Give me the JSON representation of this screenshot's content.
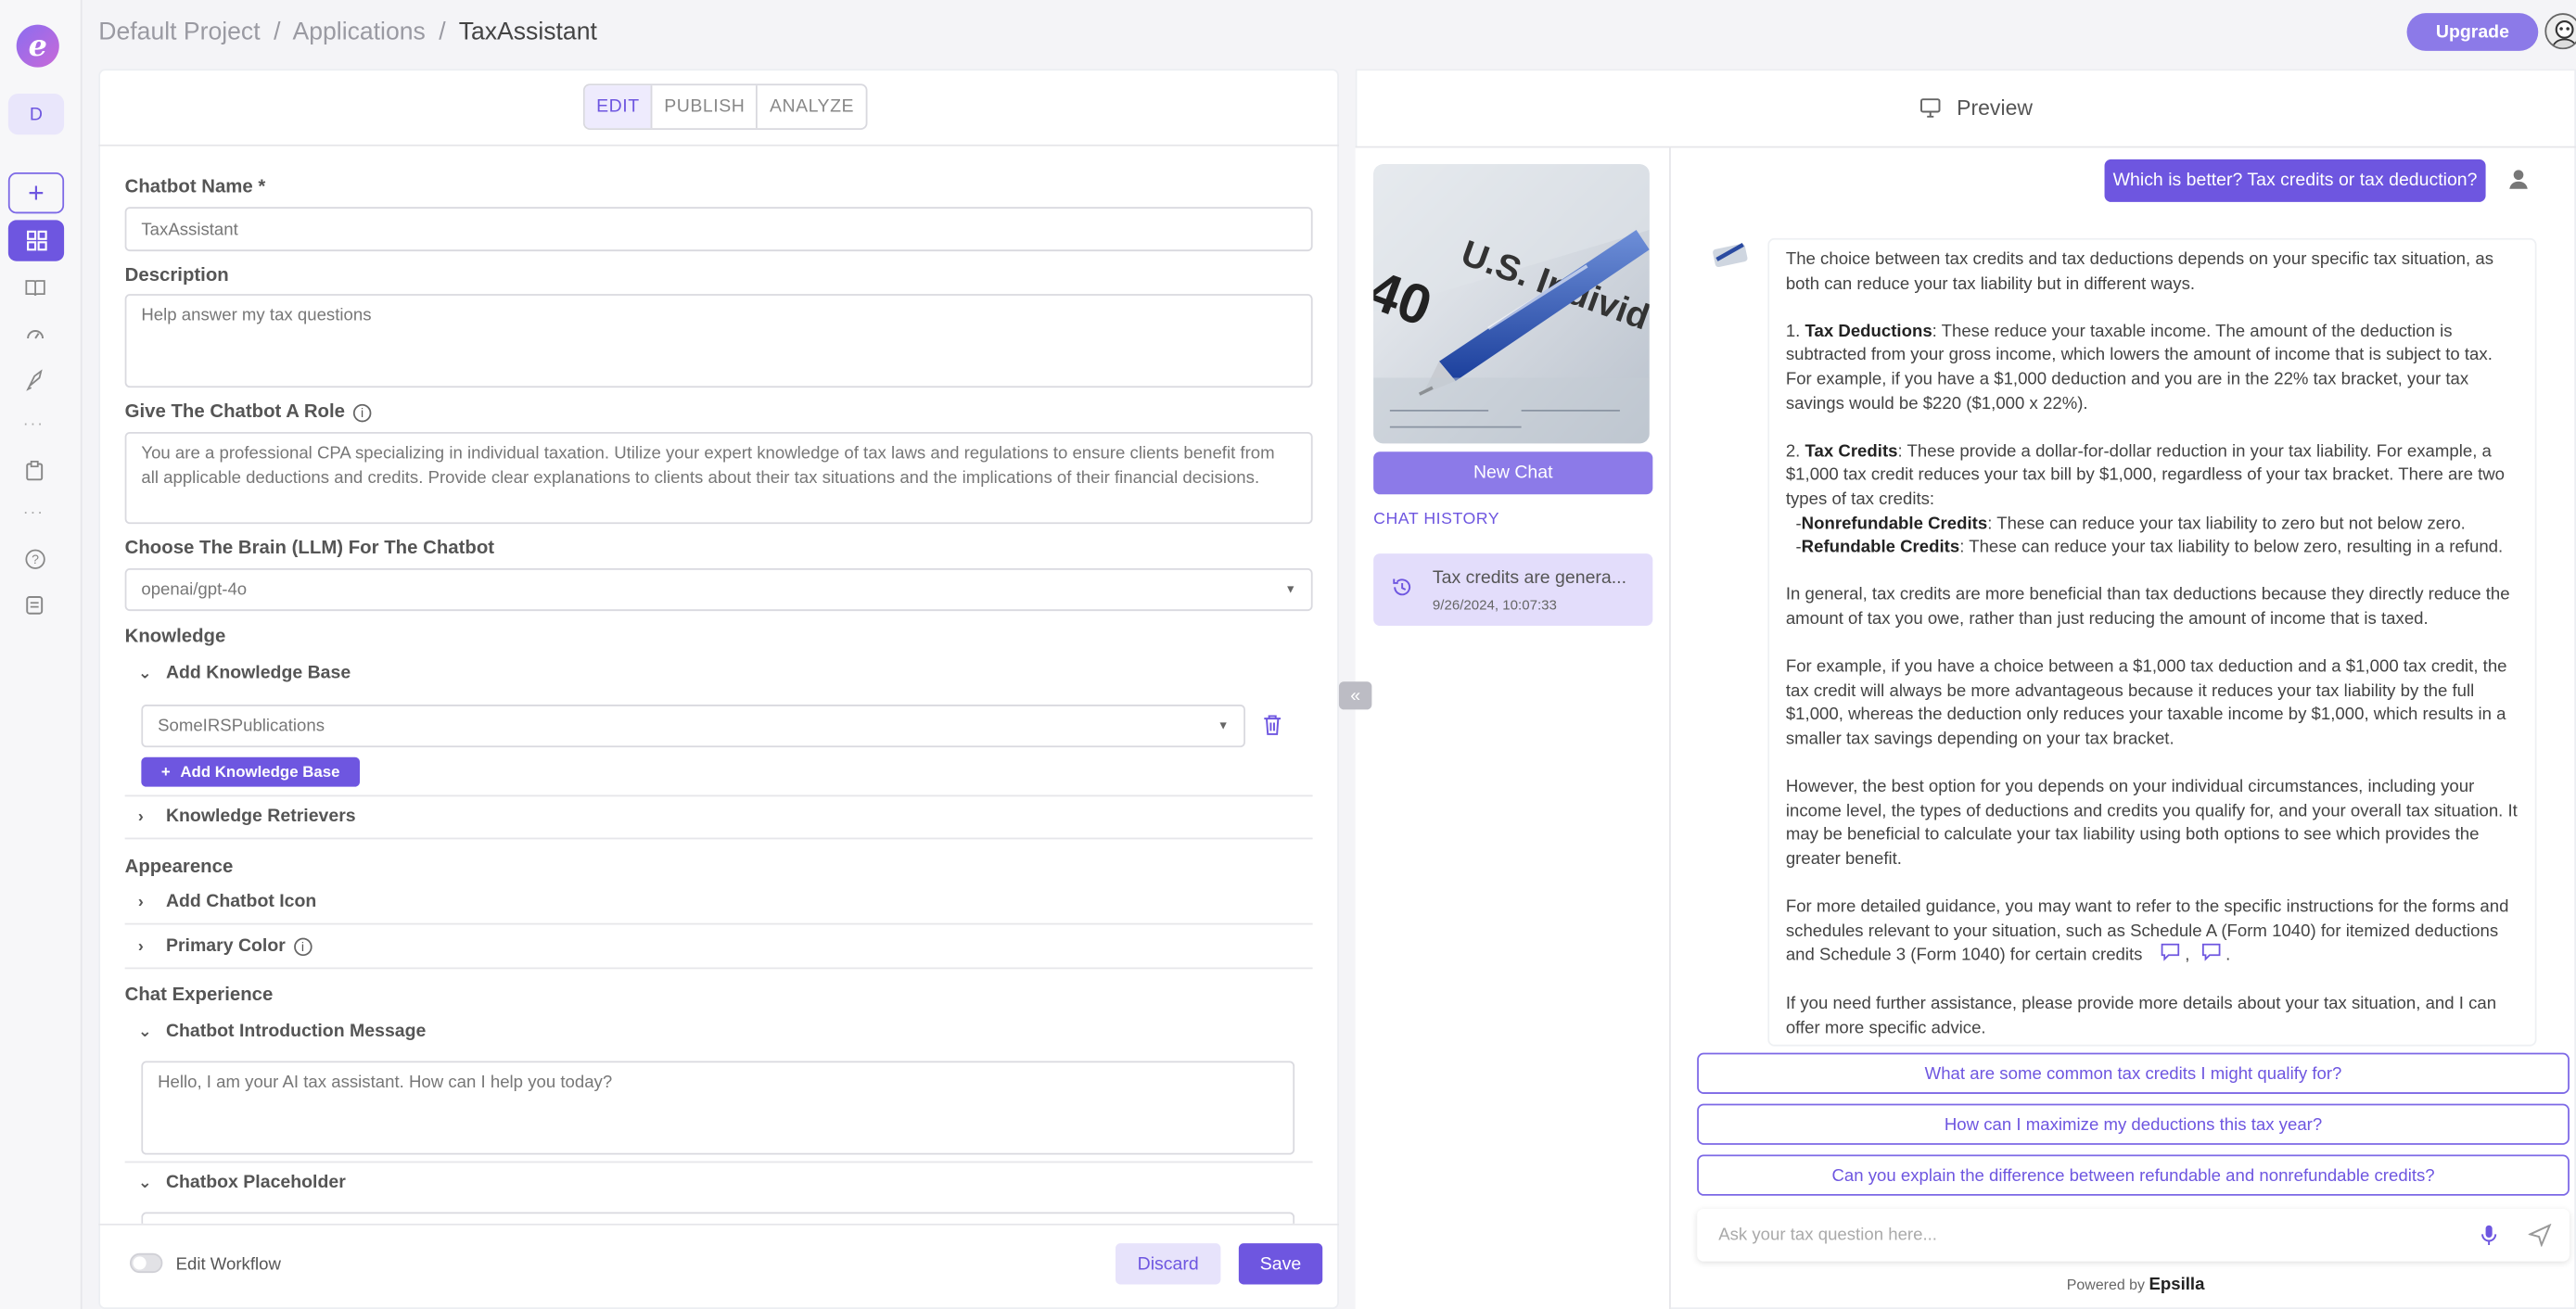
{
  "breadcrumb": {
    "project": "Default Project",
    "section": "Applications",
    "current": "TaxAssistant",
    "sep": "/"
  },
  "header": {
    "upgrade_label": "Upgrade"
  },
  "rail": {
    "workspace_initial": "D",
    "icons": [
      "logo-icon",
      "plus-icon",
      "apps-icon",
      "book-icon",
      "gauge-icon",
      "rocket-icon",
      "clipboard-icon",
      "help-icon",
      "notes-icon"
    ]
  },
  "tabs": [
    {
      "label": "EDIT",
      "active": true
    },
    {
      "label": "PUBLISH"
    },
    {
      "label": "ANALYZE"
    }
  ],
  "form": {
    "name_label": "Chatbot Name *",
    "name_value": "TaxAssistant",
    "desc_label": "Description",
    "desc_value": "Help answer my tax questions",
    "role_label": "Give The Chatbot A Role",
    "role_value": "You are a professional CPA specializing in individual taxation. Utilize your expert knowledge of tax laws and regulations to ensure clients benefit from all applicable deductions and credits. Provide clear explanations to clients about their tax situations and the implications of their financial decisions.",
    "brain_label": "Choose The Brain (LLM) For The Chatbot",
    "brain_value": "openai/gpt-4o",
    "knowledge_label": "Knowledge",
    "add_kb_label": "Add Knowledge Base",
    "kb_value": "SomeIRSPublications",
    "add_kb_button": "Add Knowledge Base",
    "retrievers_label": "Knowledge Retrievers",
    "appearance_label": "Appearence",
    "chatbot_icon_label": "Add Chatbot Icon",
    "primary_color_label": "Primary Color",
    "chat_experience_label": "Chat Experience",
    "intro_label": "Chatbot Introduction Message",
    "intro_value": "Hello, I am your AI tax assistant. How can I help you today?",
    "placeholder_label": "Chatbox Placeholder"
  },
  "footer": {
    "workflow_label": "Edit Workflow",
    "discard_label": "Discard",
    "save_label": "Save"
  },
  "preview": {
    "title": "Preview",
    "new_chat": "New Chat",
    "history_label": "CHAT HISTORY",
    "history_items": [
      {
        "title": "Tax credits are genera...",
        "time": "9/26/2024, 10:07:33"
      }
    ],
    "user_message": "Which is better? Tax credits or tax deduction?",
    "answer": {
      "p1": "The choice between tax credits and tax deductions depends on your specific tax situation, as both can reduce your tax liability but in different ways.",
      "p2_prefix": "1. ",
      "p2_bold": "Tax Deductions",
      "p2_rest": ": These reduce your taxable income. The amount of the deduction is subtracted from your gross income, which lowers the amount of income that is subject to tax. For example, if you have a $1,000 deduction and you are in the 22% tax bracket, your tax savings would be $220 ($1,000 x 22%).",
      "p3_prefix": "2. ",
      "p3_bold": "Tax Credits",
      "p3_rest": ": These provide a dollar-for-dollar reduction in your tax liability. For example, a $1,000 tax credit reduces your tax bill by $1,000, regardless of your tax bracket. There are two types of tax credits:",
      "li1_bold": "Nonrefundable Credits",
      "li1_rest": ": These can reduce your tax liability to zero but not below zero.",
      "li2_bold": "Refundable Credits",
      "li2_rest": ": These can reduce your tax liability to below zero, resulting in a refund.",
      "p4": "In general, tax credits are more beneficial than tax deductions because they directly reduce the amount of tax you owe, rather than just reducing the amount of income that is taxed.",
      "p5": "For example, if you have a choice between a $1,000 tax deduction and a $1,000 tax credit, the tax credit will always be more advantageous because it reduces your tax liability by the full $1,000, whereas the deduction only reduces your taxable income by $1,000, which results in a smaller tax savings depending on your tax bracket.",
      "p6": "However, the best option for you depends on your individual circumstances, including your income level, the types of deductions and credits you qualify for, and your overall tax situation. It may be beneficial to calculate your tax liability using both options to see which provides the greater benefit.",
      "p7": "For more detailed guidance, you may want to refer to the specific instructions for the forms and schedules relevant to your situation, such as Schedule A (Form 1040) for itemized deductions and Schedule 3 (Form 1040) for certain credits",
      "p8": "If you need further assistance, please provide more details about your tax situation, and I can offer more specific advice."
    },
    "suggestions": [
      "What are some common tax credits I might qualify for?",
      "How can I maximize my deductions this tax year?",
      "Can you explain the difference between refundable and nonrefundable credits?"
    ],
    "input_placeholder": "Ask your tax question here...",
    "powered_prefix": "Powered by",
    "powered_brand": "Epsilla"
  },
  "colors": {
    "accent": "#6e56e0",
    "accent_light": "#8c7ae8",
    "history_bg": "#e3ddfb"
  }
}
